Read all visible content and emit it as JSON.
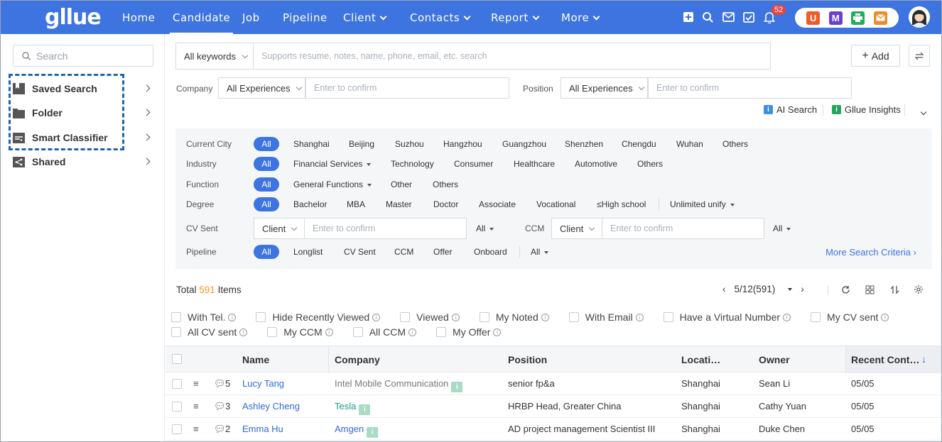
{
  "nav": {
    "logo": "gllue",
    "items": [
      {
        "label": "Home",
        "dropdown": false
      },
      {
        "label": "Candidate",
        "dropdown": false,
        "active": true
      },
      {
        "label": "Job",
        "dropdown": false
      },
      {
        "label": "Pipeline",
        "dropdown": false
      },
      {
        "label": "Client",
        "dropdown": true
      },
      {
        "label": "Contacts",
        "dropdown": true
      },
      {
        "label": "Report",
        "dropdown": true
      },
      {
        "label": "More",
        "dropdown": true
      }
    ],
    "notification_count": "52",
    "apps": [
      {
        "letter": "U",
        "color": "#f05a28"
      },
      {
        "letter": "M",
        "color": "#6b3fd1"
      },
      {
        "letter": "",
        "color": "#1fae5b"
      },
      {
        "letter": "",
        "color": "#f08a2c"
      }
    ]
  },
  "sidebar": {
    "search_placeholder": "Search",
    "items": [
      {
        "label": "Saved Search"
      },
      {
        "label": "Folder"
      },
      {
        "label": "Smart Classifier"
      },
      {
        "label": "Shared"
      }
    ]
  },
  "search": {
    "scope": "All keywords",
    "placeholder": "Supports resume, notes, name, phone, email, etc. search",
    "add_label": "Add",
    "company_label": "Company",
    "company_scope": "All Experiences",
    "company_placeholder": "Enter to confirm",
    "position_label": "Position",
    "position_scope": "All Experiences",
    "position_placeholder": "Enter to confirm",
    "ai_search": "AI Search",
    "insights": "Gllue Insights"
  },
  "filters": {
    "rows": [
      {
        "label": "Current City",
        "all": "All",
        "options": [
          "Shanghai",
          "Beijing",
          "Suzhou",
          "Hangzhou",
          "Guangzhou",
          "Shenzhen",
          "Chengdu",
          "Wuhan",
          "Others"
        ]
      },
      {
        "label": "Industry",
        "all": "All",
        "options": [
          "Financial Services",
          "Technology",
          "Consumer",
          "Healthcare",
          "Automotive",
          "Others"
        ]
      },
      {
        "label": "Function",
        "all": "All",
        "options": [
          "General Functions",
          "Other",
          "Others"
        ]
      },
      {
        "label": "Degree",
        "all": "All",
        "options": [
          "Bachelor",
          "MBA",
          "Master",
          "Doctor",
          "Associate",
          "Vocational",
          "≤High school",
          "Unlimited unify"
        ]
      }
    ],
    "cv_sent": {
      "label": "CV Sent",
      "scope": "Client",
      "placeholder": "Enter to confirm",
      "all": "All"
    },
    "ccm": {
      "label": "CCM",
      "scope": "Client",
      "placeholder": "Enter to confirm",
      "all": "All"
    },
    "pipeline": {
      "label": "Pipeline",
      "all": "All",
      "options": [
        "Longlist",
        "CV Sent",
        "CCM",
        "Offer",
        "Onboard",
        "All"
      ]
    },
    "more": "More Search Criteria"
  },
  "results": {
    "total_prefix": "Total",
    "total_count": "591",
    "total_suffix": "Items",
    "page": "5/12(591)"
  },
  "checks": {
    "row1": [
      "With Tel.",
      "Hide Recently Viewed",
      "Viewed",
      "My Noted",
      "With Email",
      "Have a Virtual Number",
      "My CV sent"
    ],
    "row2": [
      "All CV sent",
      "My CCM",
      "All CCM",
      "My Offer"
    ]
  },
  "table": {
    "headers": [
      "Name",
      "Company",
      "Position",
      "Locati…",
      "Owner",
      "Recent Cont…"
    ],
    "rows": [
      {
        "comments": "5",
        "name": "Lucy Tang",
        "company": "Intel Mobile Communication",
        "position": "senior fp&a",
        "location": "Shanghai",
        "owner": "Sean Li",
        "recent": "05/05"
      },
      {
        "comments": "3",
        "name": "Ashley Cheng",
        "company": "Tesla",
        "position": "HRBP Head, Greater China",
        "location": "Shanghai",
        "owner": "Cathy Yuan",
        "recent": "05/05"
      },
      {
        "comments": "2",
        "name": "Emma Hu",
        "company": "Amgen",
        "position": "AD project management Scientist III",
        "location": "Shanghai",
        "owner": "Duke Chen",
        "recent": "05/05"
      }
    ]
  }
}
